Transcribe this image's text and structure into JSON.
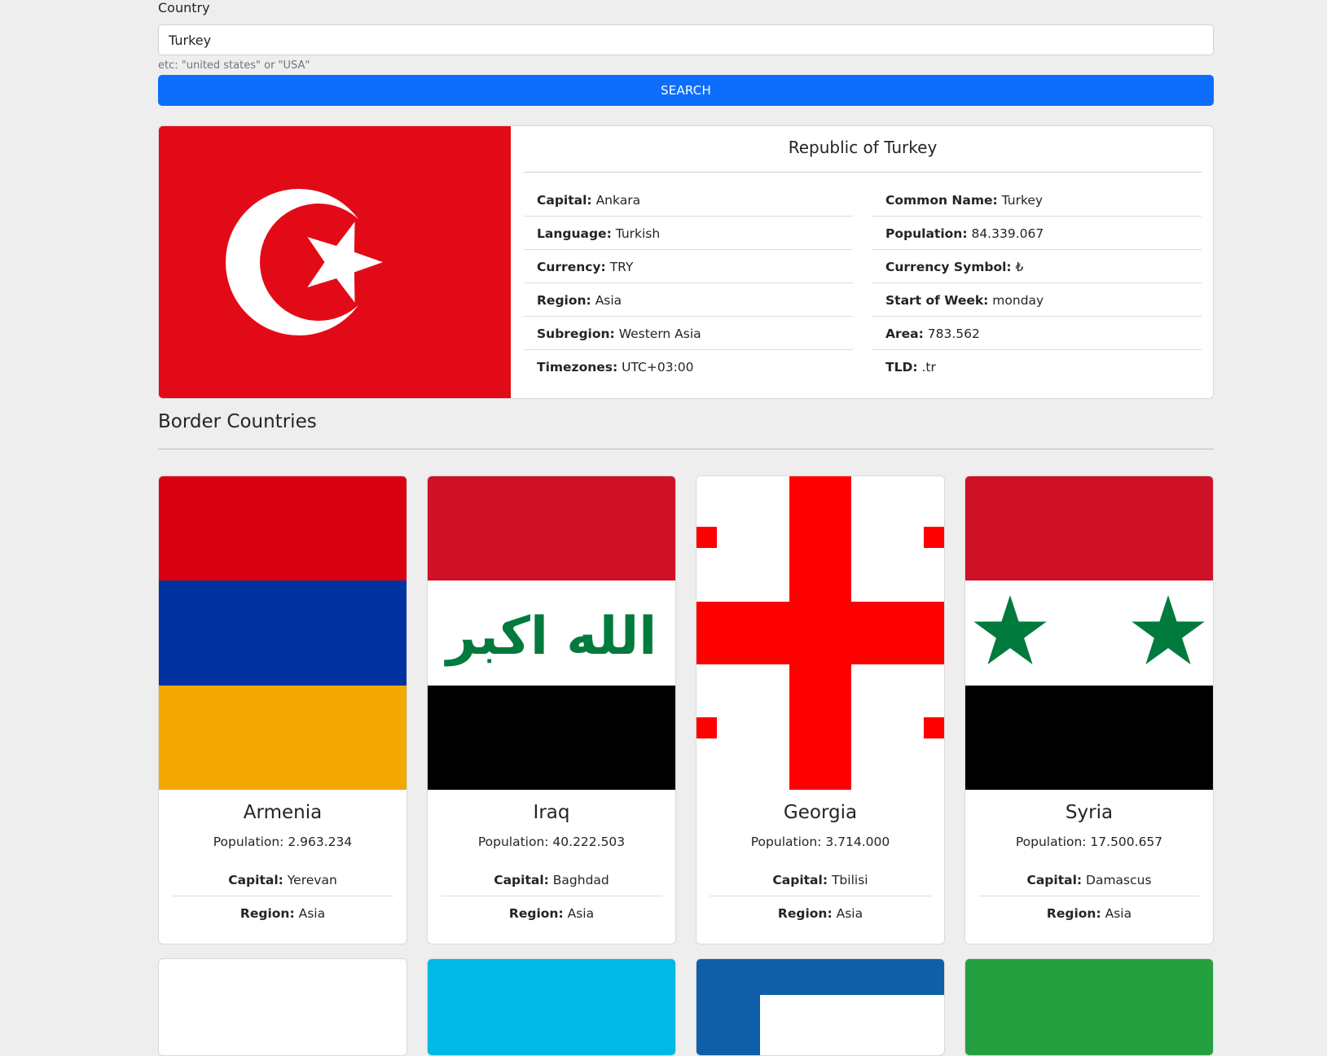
{
  "search": {
    "label": "Country",
    "value": "Turkey",
    "hint": "etc: \"united states\" or \"USA\"",
    "button_label": "SEARCH"
  },
  "country": {
    "official_name": "Republic of Turkey",
    "left": [
      {
        "label": "Capital:",
        "value": "Ankara"
      },
      {
        "label": "Language:",
        "value": "Turkish"
      },
      {
        "label": "Currency:",
        "value": "TRY"
      },
      {
        "label": "Region:",
        "value": "Asia"
      },
      {
        "label": "Subregion:",
        "value": "Western Asia"
      },
      {
        "label": "Timezones:",
        "value": "UTC+03:00"
      }
    ],
    "right": [
      {
        "label": "Common Name:",
        "value": "Turkey"
      },
      {
        "label": "Population:",
        "value": "84.339.067"
      },
      {
        "label": "Currency Symbol:",
        "value": "₺"
      },
      {
        "label": "Start of Week:",
        "value": "monday"
      },
      {
        "label": "Area:",
        "value": "783.562"
      },
      {
        "label": "TLD:",
        "value": ".tr"
      }
    ],
    "flag_colors": {
      "red": "#e30a17",
      "white": "#ffffff"
    }
  },
  "border_section_title": "Border Countries",
  "border_countries": [
    {
      "name": "Armenia",
      "population": "Population: 2.963.234",
      "capital_label": "Capital:",
      "capital": "Yerevan",
      "region_label": "Region:",
      "region": "Asia"
    },
    {
      "name": "Iraq",
      "population": "Population: 40.222.503",
      "capital_label": "Capital:",
      "capital": "Baghdad",
      "region_label": "Region:",
      "region": "Asia"
    },
    {
      "name": "Georgia",
      "population": "Population: 3.714.000",
      "capital_label": "Capital:",
      "capital": "Tbilisi",
      "region_label": "Region:",
      "region": "Asia"
    },
    {
      "name": "Syria",
      "population": "Population: 17.500.657",
      "capital_label": "Capital:",
      "capital": "Damascus",
      "region_label": "Region:",
      "region": "Asia"
    }
  ],
  "iraq_flag_script": "الله اكبر",
  "colors": {
    "accent": "#0d6efd",
    "page_bg": "#eeeeee",
    "armenia": [
      "#d90012",
      "#0033a0",
      "#f2a800"
    ],
    "iraq": [
      "#ce1126",
      "#ffffff",
      "#000000",
      "#007a3d"
    ],
    "georgia": [
      "#ffffff",
      "#ff0000"
    ],
    "syria": [
      "#ce1126",
      "#ffffff",
      "#000000",
      "#007a3d"
    ],
    "partial_flags": [
      "#ffffff",
      "#00b9e4",
      "#0f5ea8",
      "#24a040"
    ]
  }
}
